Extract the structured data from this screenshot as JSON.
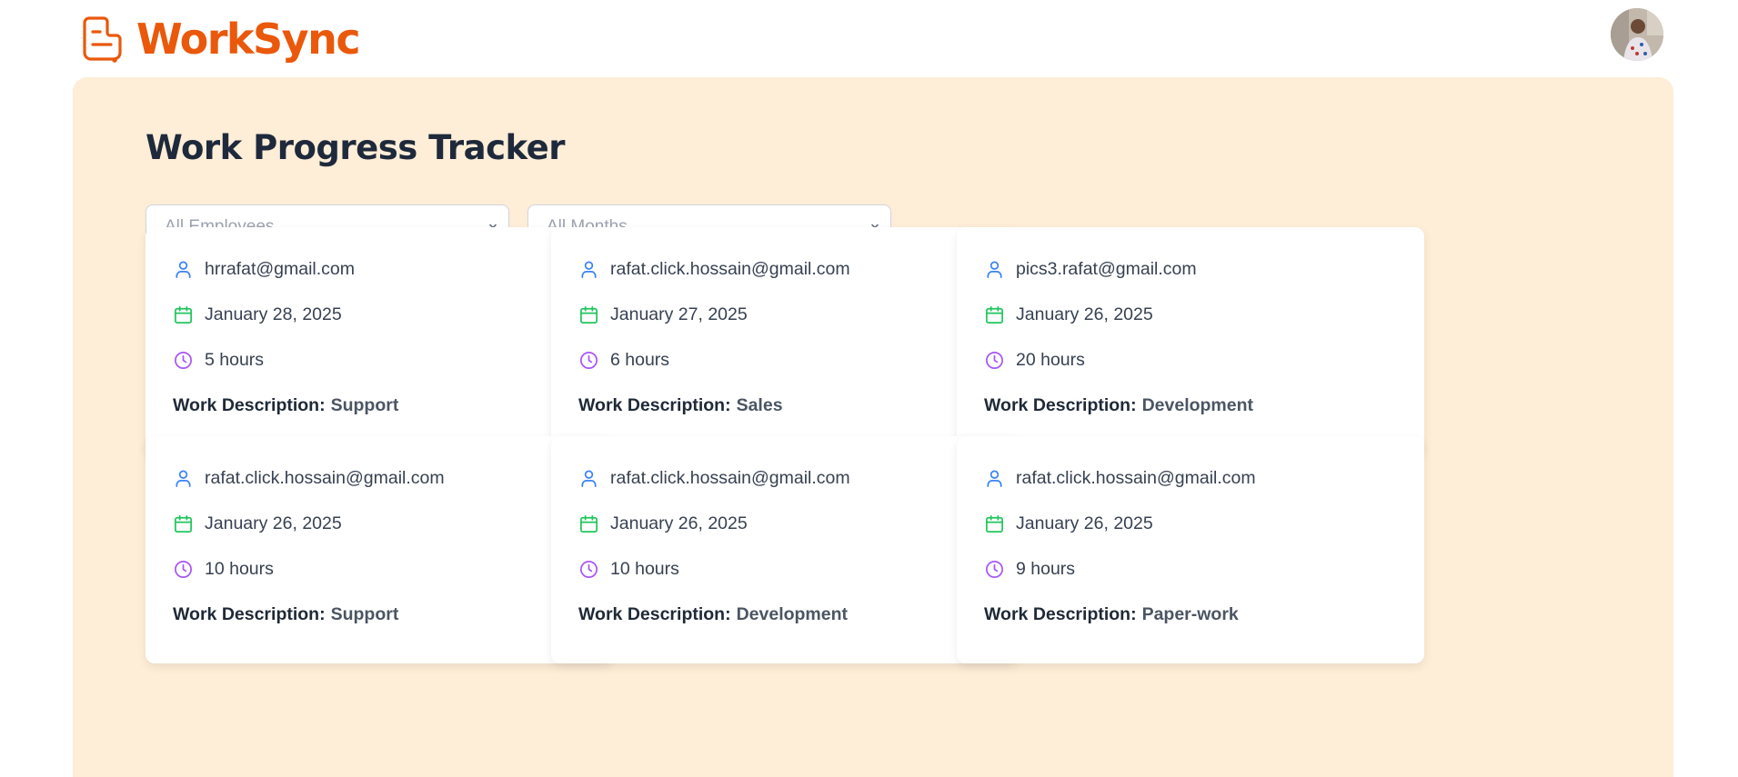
{
  "app": {
    "name": "WorkSync"
  },
  "header": {
    "avatar_icon": "user-avatar-photo"
  },
  "page": {
    "title": "Work Progress Tracker"
  },
  "filters": {
    "employee": {
      "selected": "All Employees"
    },
    "month": {
      "selected": "All Months"
    }
  },
  "colors": {
    "brand": "#ea580c",
    "panel_bg": "#feedd7",
    "user_icon": "#3b82f6",
    "calendar_icon": "#22c55e",
    "clock_icon": "#a855f7"
  },
  "cards": [
    {
      "email": "hrrafat@gmail.com",
      "date": "January 28, 2025",
      "hours": "5 hours",
      "desc_label": "Work Description:",
      "desc": "Support"
    },
    {
      "email": "rafat.click.hossain@gmail.com",
      "date": "January 27, 2025",
      "hours": "6 hours",
      "desc_label": "Work Description:",
      "desc": "Sales"
    },
    {
      "email": "pics3.rafat@gmail.com",
      "date": "January 26, 2025",
      "hours": "20 hours",
      "desc_label": "Work Description:",
      "desc": "Development"
    },
    {
      "email": "rafat.click.hossain@gmail.com",
      "date": "January 26, 2025",
      "hours": "10 hours",
      "desc_label": "Work Description:",
      "desc": "Support"
    },
    {
      "email": "rafat.click.hossain@gmail.com",
      "date": "January 26, 2025",
      "hours": "10 hours",
      "desc_label": "Work Description:",
      "desc": "Development"
    },
    {
      "email": "rafat.click.hossain@gmail.com",
      "date": "January 26, 2025",
      "hours": "9 hours",
      "desc_label": "Work Description:",
      "desc": "Paper-work"
    }
  ]
}
